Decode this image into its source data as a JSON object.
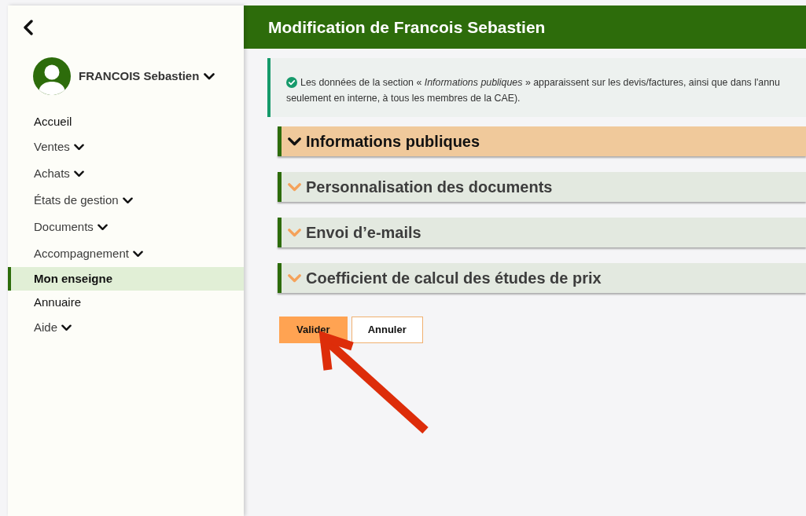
{
  "sidebar": {
    "user": {
      "name": "FRANCOIS Sebastien"
    },
    "menu": [
      {
        "label": "Accueil",
        "has_submenu": false,
        "selected": false
      },
      {
        "label": "Ventes",
        "has_submenu": true,
        "selected": false
      },
      {
        "label": "Achats",
        "has_submenu": true,
        "selected": false
      },
      {
        "label": "États de gestion",
        "has_submenu": true,
        "selected": false
      },
      {
        "label": "Documents",
        "has_submenu": true,
        "selected": false
      },
      {
        "label": "Accompagnement",
        "has_submenu": true,
        "selected": false
      },
      {
        "label": "Mon enseigne",
        "has_submenu": false,
        "selected": true
      },
      {
        "label": "Annuaire",
        "has_submenu": false,
        "selected": false
      },
      {
        "label": "Aide",
        "has_submenu": true,
        "selected": false
      }
    ]
  },
  "header": {
    "title": "Modification de Francois Sebastien"
  },
  "notice": {
    "lines": [
      "Les données de la section « *Informations publiques* » apparaissent sur les devis/factures, ainsi que dans l'annu",
      "seulement en interne, à tous les membres de la CAE)."
    ]
  },
  "sections": [
    {
      "title": "Informations publiques",
      "selected": true
    },
    {
      "title": "Personnalisation des documents",
      "selected": false
    },
    {
      "title": "Envoi d’e-mails",
      "selected": false
    },
    {
      "title": "Coefficient de calcul des études de prix",
      "selected": false
    }
  ],
  "buttons": [
    {
      "label": "Valider",
      "kind": "primary"
    },
    {
      "label": "Annuler",
      "kind": "secondary"
    }
  ]
}
